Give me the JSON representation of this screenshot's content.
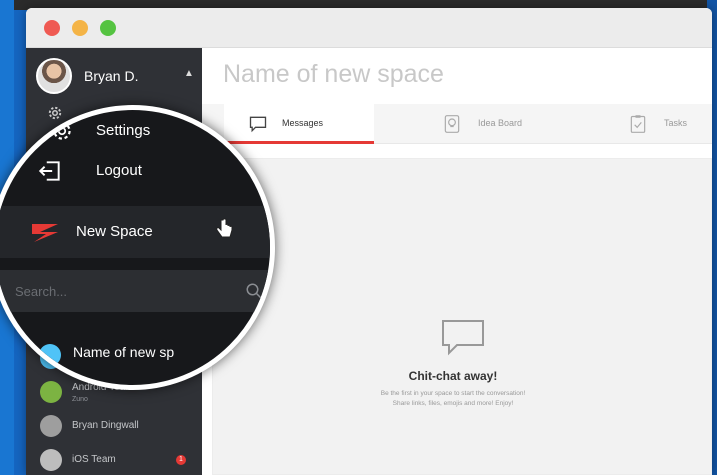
{
  "user": {
    "name": "Bryan D."
  },
  "menu": {
    "settings_label": "Settings",
    "logout_label": "Logout"
  },
  "new_space_label": "New Space",
  "search": {
    "placeholder": "Search..."
  },
  "spaces": [
    {
      "name": "Name of new sp",
      "sub": "",
      "icon": "space-icon",
      "color": "#4fc3f7",
      "badge": ""
    },
    {
      "name": "Android Team",
      "sub": "Zuno",
      "icon": "android-icon",
      "color": "#7cb342",
      "badge": ""
    },
    {
      "name": "Bryan Dingwall",
      "sub": "",
      "icon": "avatar-icon",
      "color": "#9e9e9e",
      "badge": ""
    },
    {
      "name": "iOS Team",
      "sub": "",
      "icon": "apple-icon",
      "color": "#bdbdbd",
      "badge": "1"
    }
  ],
  "main": {
    "space_title": "Name of new space",
    "tabs": [
      {
        "label": "Messages",
        "icon": "chat-icon",
        "active": true
      },
      {
        "label": "Idea Board",
        "icon": "lightbulb-icon",
        "active": false
      },
      {
        "label": "Tasks",
        "icon": "clipboard-icon",
        "active": false
      }
    ],
    "empty_title": "Chit-chat away!",
    "empty_line1": "Be the first in your space to start the conversation!",
    "empty_line2": "Share links, files, emojis and more! Enjoy!"
  },
  "colors": {
    "accent": "#e53935",
    "sidebar": "#2f3136",
    "window_red": "#ef5a53",
    "window_yellow": "#f4b447",
    "window_green": "#55c341"
  }
}
